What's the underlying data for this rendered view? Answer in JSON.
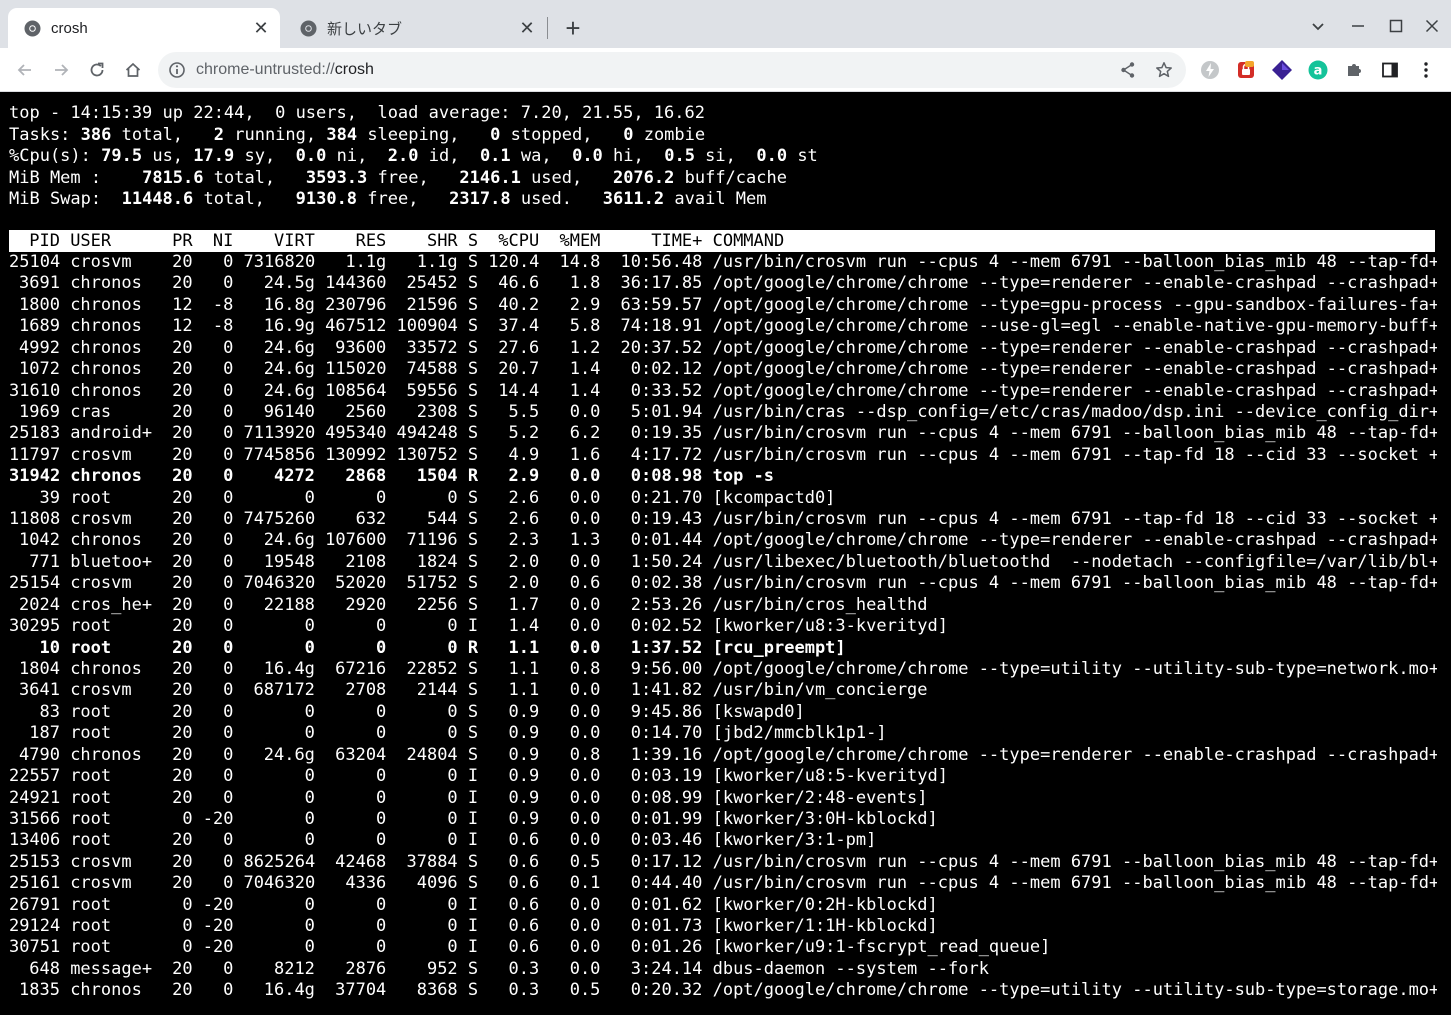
{
  "browser": {
    "tabs": [
      {
        "title": "crosh",
        "active": true
      },
      {
        "title": "新しいタブ",
        "active": false
      }
    ],
    "new_tab_label": "+",
    "url_scheme": "chrome-untrusted://",
    "url_host": "crosh",
    "extension_icons": [
      "lightning-extension-icon",
      "lastpass-extension-icon",
      "obsidian-extension-icon",
      "grammarly-extension-icon",
      "puzzle-extensions-icon",
      "side-panel-icon",
      "kebab-menu-icon"
    ]
  },
  "top": {
    "summary": {
      "line1": "top - 14:15:39 up 22:44,  0 users,  load average: 7.20, 21.55, 16.62",
      "tasks": {
        "label": "Tasks:",
        "total": "386",
        "running": "2",
        "sleeping": "384",
        "stopped": "0",
        "zombie": "0"
      },
      "cpu": {
        "label": "%Cpu(s):",
        "us": "79.5",
        "sy": "17.9",
        "ni": "0.0",
        "id": "2.0",
        "wa": "0.1",
        "hi": "0.0",
        "si": "0.5",
        "st": "0.0"
      },
      "mem": {
        "label": "MiB Mem :",
        "total": "7815.6",
        "free": "3593.3",
        "used": "2146.1",
        "buff_cache": "2076.2"
      },
      "swap": {
        "label": "MiB Swap:",
        "total": "11448.6",
        "free": "9130.8",
        "used": "2317.8",
        "avail_mem": "3611.2"
      }
    },
    "columns": [
      "PID",
      "USER",
      "PR",
      "NI",
      "VIRT",
      "RES",
      "SHR",
      "S",
      "%CPU",
      "%MEM",
      "TIME+",
      "COMMAND"
    ],
    "processes": [
      {
        "pid": "25104",
        "user": "crosvm",
        "pr": "20",
        "ni": "0",
        "virt": "7316820",
        "res": "1.1g",
        "shr": "1.1g",
        "s": "S",
        "cpu": "120.4",
        "mem": "14.8",
        "time": "10:56.48",
        "cmd": "/usr/bin/crosvm run --cpus 4 --mem 6791 --balloon_bias_mib 48 --tap-fd+"
      },
      {
        "pid": "3691",
        "user": "chronos",
        "pr": "20",
        "ni": "0",
        "virt": "24.5g",
        "res": "144360",
        "shr": "25452",
        "s": "S",
        "cpu": "46.6",
        "mem": "1.8",
        "time": "36:17.85",
        "cmd": "/opt/google/chrome/chrome --type=renderer --enable-crashpad --crashpad+"
      },
      {
        "pid": "1800",
        "user": "chronos",
        "pr": "12",
        "ni": "-8",
        "virt": "16.8g",
        "res": "230796",
        "shr": "21596",
        "s": "S",
        "cpu": "40.2",
        "mem": "2.9",
        "time": "63:59.57",
        "cmd": "/opt/google/chrome/chrome --type=gpu-process --gpu-sandbox-failures-fa+"
      },
      {
        "pid": "1689",
        "user": "chronos",
        "pr": "12",
        "ni": "-8",
        "virt": "16.9g",
        "res": "467512",
        "shr": "100904",
        "s": "S",
        "cpu": "37.4",
        "mem": "5.8",
        "time": "74:18.91",
        "cmd": "/opt/google/chrome/chrome --use-gl=egl --enable-native-gpu-memory-buff+"
      },
      {
        "pid": "4992",
        "user": "chronos",
        "pr": "20",
        "ni": "0",
        "virt": "24.6g",
        "res": "93600",
        "shr": "33572",
        "s": "S",
        "cpu": "27.6",
        "mem": "1.2",
        "time": "20:37.52",
        "cmd": "/opt/google/chrome/chrome --type=renderer --enable-crashpad --crashpad+"
      },
      {
        "pid": "1072",
        "user": "chronos",
        "pr": "20",
        "ni": "0",
        "virt": "24.6g",
        "res": "115020",
        "shr": "74588",
        "s": "S",
        "cpu": "20.7",
        "mem": "1.4",
        "time": "0:02.12",
        "cmd": "/opt/google/chrome/chrome --type=renderer --enable-crashpad --crashpad+"
      },
      {
        "pid": "31610",
        "user": "chronos",
        "pr": "20",
        "ni": "0",
        "virt": "24.6g",
        "res": "108564",
        "shr": "59556",
        "s": "S",
        "cpu": "14.4",
        "mem": "1.4",
        "time": "0:33.52",
        "cmd": "/opt/google/chrome/chrome --type=renderer --enable-crashpad --crashpad+"
      },
      {
        "pid": "1969",
        "user": "cras",
        "pr": "20",
        "ni": "0",
        "virt": "96140",
        "res": "2560",
        "shr": "2308",
        "s": "S",
        "cpu": "5.5",
        "mem": "0.0",
        "time": "5:01.94",
        "cmd": "/usr/bin/cras --dsp_config=/etc/cras/madoo/dsp.ini --device_config_dir+"
      },
      {
        "pid": "25183",
        "user": "android+",
        "pr": "20",
        "ni": "0",
        "virt": "7113920",
        "res": "495340",
        "shr": "494248",
        "s": "S",
        "cpu": "5.2",
        "mem": "6.2",
        "time": "0:19.35",
        "cmd": "/usr/bin/crosvm run --cpus 4 --mem 6791 --balloon_bias_mib 48 --tap-fd+"
      },
      {
        "pid": "11797",
        "user": "crosvm",
        "pr": "20",
        "ni": "0",
        "virt": "7745856",
        "res": "130992",
        "shr": "130752",
        "s": "S",
        "cpu": "4.9",
        "mem": "1.6",
        "time": "4:17.72",
        "cmd": "/usr/bin/crosvm run --cpus 4 --mem 6791 --tap-fd 18 --cid 33 --socket +"
      },
      {
        "pid": "31942",
        "user": "chronos",
        "pr": "20",
        "ni": "0",
        "virt": "4272",
        "res": "2868",
        "shr": "1504",
        "s": "R",
        "cpu": "2.9",
        "mem": "0.0",
        "time": "0:08.98",
        "cmd": "top -s",
        "bold": true
      },
      {
        "pid": "39",
        "user": "root",
        "pr": "20",
        "ni": "0",
        "virt": "0",
        "res": "0",
        "shr": "0",
        "s": "S",
        "cpu": "2.6",
        "mem": "0.0",
        "time": "0:21.70",
        "cmd": "[kcompactd0]"
      },
      {
        "pid": "11808",
        "user": "crosvm",
        "pr": "20",
        "ni": "0",
        "virt": "7475260",
        "res": "632",
        "shr": "544",
        "s": "S",
        "cpu": "2.6",
        "mem": "0.0",
        "time": "0:19.43",
        "cmd": "/usr/bin/crosvm run --cpus 4 --mem 6791 --tap-fd 18 --cid 33 --socket +"
      },
      {
        "pid": "1042",
        "user": "chronos",
        "pr": "20",
        "ni": "0",
        "virt": "24.6g",
        "res": "107600",
        "shr": "71196",
        "s": "S",
        "cpu": "2.3",
        "mem": "1.3",
        "time": "0:01.44",
        "cmd": "/opt/google/chrome/chrome --type=renderer --enable-crashpad --crashpad+"
      },
      {
        "pid": "771",
        "user": "bluetoo+",
        "pr": "20",
        "ni": "0",
        "virt": "19548",
        "res": "2108",
        "shr": "1824",
        "s": "S",
        "cpu": "2.0",
        "mem": "0.0",
        "time": "1:50.24",
        "cmd": "/usr/libexec/bluetooth/bluetoothd  --nodetach --configfile=/var/lib/bl+"
      },
      {
        "pid": "25154",
        "user": "crosvm",
        "pr": "20",
        "ni": "0",
        "virt": "7046320",
        "res": "52020",
        "shr": "51752",
        "s": "S",
        "cpu": "2.0",
        "mem": "0.6",
        "time": "0:02.38",
        "cmd": "/usr/bin/crosvm run --cpus 4 --mem 6791 --balloon_bias_mib 48 --tap-fd+"
      },
      {
        "pid": "2024",
        "user": "cros_he+",
        "pr": "20",
        "ni": "0",
        "virt": "22188",
        "res": "2920",
        "shr": "2256",
        "s": "S",
        "cpu": "1.7",
        "mem": "0.0",
        "time": "2:53.26",
        "cmd": "/usr/bin/cros_healthd"
      },
      {
        "pid": "30295",
        "user": "root",
        "pr": "20",
        "ni": "0",
        "virt": "0",
        "res": "0",
        "shr": "0",
        "s": "I",
        "cpu": "1.4",
        "mem": "0.0",
        "time": "0:02.52",
        "cmd": "[kworker/u8:3-kverityd]"
      },
      {
        "pid": "10",
        "user": "root",
        "pr": "20",
        "ni": "0",
        "virt": "0",
        "res": "0",
        "shr": "0",
        "s": "R",
        "cpu": "1.1",
        "mem": "0.0",
        "time": "1:37.52",
        "cmd": "[rcu_preempt]",
        "bold": true
      },
      {
        "pid": "1804",
        "user": "chronos",
        "pr": "20",
        "ni": "0",
        "virt": "16.4g",
        "res": "67216",
        "shr": "22852",
        "s": "S",
        "cpu": "1.1",
        "mem": "0.8",
        "time": "9:56.00",
        "cmd": "/opt/google/chrome/chrome --type=utility --utility-sub-type=network.mo+"
      },
      {
        "pid": "3641",
        "user": "crosvm",
        "pr": "20",
        "ni": "0",
        "virt": "687172",
        "res": "2708",
        "shr": "2144",
        "s": "S",
        "cpu": "1.1",
        "mem": "0.0",
        "time": "1:41.82",
        "cmd": "/usr/bin/vm_concierge"
      },
      {
        "pid": "83",
        "user": "root",
        "pr": "20",
        "ni": "0",
        "virt": "0",
        "res": "0",
        "shr": "0",
        "s": "S",
        "cpu": "0.9",
        "mem": "0.0",
        "time": "9:45.86",
        "cmd": "[kswapd0]"
      },
      {
        "pid": "187",
        "user": "root",
        "pr": "20",
        "ni": "0",
        "virt": "0",
        "res": "0",
        "shr": "0",
        "s": "S",
        "cpu": "0.9",
        "mem": "0.0",
        "time": "0:14.70",
        "cmd": "[jbd2/mmcblk1p1-]"
      },
      {
        "pid": "4790",
        "user": "chronos",
        "pr": "20",
        "ni": "0",
        "virt": "24.6g",
        "res": "63204",
        "shr": "24804",
        "s": "S",
        "cpu": "0.9",
        "mem": "0.8",
        "time": "1:39.16",
        "cmd": "/opt/google/chrome/chrome --type=renderer --enable-crashpad --crashpad+"
      },
      {
        "pid": "22557",
        "user": "root",
        "pr": "20",
        "ni": "0",
        "virt": "0",
        "res": "0",
        "shr": "0",
        "s": "I",
        "cpu": "0.9",
        "mem": "0.0",
        "time": "0:03.19",
        "cmd": "[kworker/u8:5-kverityd]"
      },
      {
        "pid": "24921",
        "user": "root",
        "pr": "20",
        "ni": "0",
        "virt": "0",
        "res": "0",
        "shr": "0",
        "s": "I",
        "cpu": "0.9",
        "mem": "0.0",
        "time": "0:08.99",
        "cmd": "[kworker/2:48-events]"
      },
      {
        "pid": "31566",
        "user": "root",
        "pr": "0",
        "ni": "-20",
        "virt": "0",
        "res": "0",
        "shr": "0",
        "s": "I",
        "cpu": "0.9",
        "mem": "0.0",
        "time": "0:01.99",
        "cmd": "[kworker/3:0H-kblockd]"
      },
      {
        "pid": "13406",
        "user": "root",
        "pr": "20",
        "ni": "0",
        "virt": "0",
        "res": "0",
        "shr": "0",
        "s": "I",
        "cpu": "0.6",
        "mem": "0.0",
        "time": "0:03.46",
        "cmd": "[kworker/3:1-pm]"
      },
      {
        "pid": "25153",
        "user": "crosvm",
        "pr": "20",
        "ni": "0",
        "virt": "8625264",
        "res": "42468",
        "shr": "37884",
        "s": "S",
        "cpu": "0.6",
        "mem": "0.5",
        "time": "0:17.12",
        "cmd": "/usr/bin/crosvm run --cpus 4 --mem 6791 --balloon_bias_mib 48 --tap-fd+"
      },
      {
        "pid": "25161",
        "user": "crosvm",
        "pr": "20",
        "ni": "0",
        "virt": "7046320",
        "res": "4336",
        "shr": "4096",
        "s": "S",
        "cpu": "0.6",
        "mem": "0.1",
        "time": "0:44.40",
        "cmd": "/usr/bin/crosvm run --cpus 4 --mem 6791 --balloon_bias_mib 48 --tap-fd+"
      },
      {
        "pid": "26791",
        "user": "root",
        "pr": "0",
        "ni": "-20",
        "virt": "0",
        "res": "0",
        "shr": "0",
        "s": "I",
        "cpu": "0.6",
        "mem": "0.0",
        "time": "0:01.62",
        "cmd": "[kworker/0:2H-kblockd]"
      },
      {
        "pid": "29124",
        "user": "root",
        "pr": "0",
        "ni": "-20",
        "virt": "0",
        "res": "0",
        "shr": "0",
        "s": "I",
        "cpu": "0.6",
        "mem": "0.0",
        "time": "0:01.73",
        "cmd": "[kworker/1:1H-kblockd]"
      },
      {
        "pid": "30751",
        "user": "root",
        "pr": "0",
        "ni": "-20",
        "virt": "0",
        "res": "0",
        "shr": "0",
        "s": "I",
        "cpu": "0.6",
        "mem": "0.0",
        "time": "0:01.26",
        "cmd": "[kworker/u9:1-fscrypt_read_queue]"
      },
      {
        "pid": "648",
        "user": "message+",
        "pr": "20",
        "ni": "0",
        "virt": "8212",
        "res": "2876",
        "shr": "952",
        "s": "S",
        "cpu": "0.3",
        "mem": "0.0",
        "time": "3:24.14",
        "cmd": "dbus-daemon --system --fork"
      },
      {
        "pid": "1835",
        "user": "chronos",
        "pr": "20",
        "ni": "0",
        "virt": "16.4g",
        "res": "37704",
        "shr": "8368",
        "s": "S",
        "cpu": "0.3",
        "mem": "0.5",
        "time": "0:20.32",
        "cmd": "/opt/google/chrome/chrome --type=utility --utility-sub-type=storage.mo+"
      }
    ]
  }
}
